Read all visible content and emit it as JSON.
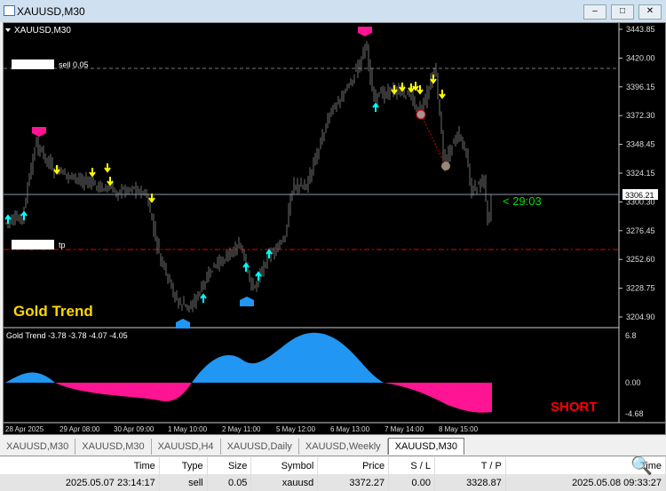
{
  "window": {
    "title": "XAUUSD,M30",
    "minimize": "‒",
    "maximize": "□",
    "close": "✕"
  },
  "chart": {
    "symbol_label": "XAUUSD,M30",
    "sell_label": "sell 0.05",
    "tp_label": "tp",
    "current_price": "3306.21",
    "countdown": "< 29:03",
    "title_text": "Gold Trend",
    "signal": "SHORT",
    "price_axis": [
      "3443.85",
      "3420.00",
      "3396.15",
      "3372.30",
      "3348.45",
      "3324.15",
      "3300.30",
      "3276.45",
      "3252.60",
      "3228.75",
      "3204.90"
    ],
    "indicator_label": "Gold Trend  -3.78 -3.78 -4.07 -4.05",
    "indicator_axis": [
      "6.8",
      "0.00",
      "-4.68"
    ],
    "time_axis": [
      "28 Apr 2025",
      "29 Apr 08:00",
      "30 Apr 09:00",
      "1 May 10:00",
      "2 May 11:00",
      "5 May 12:00",
      "6 May 13:00",
      "7 May 14:00",
      "8 May 15:00"
    ],
    "colors": {
      "bull_area": "#2196f3",
      "bear_area": "#ff1493",
      "buy_arrow": "#00ffff",
      "sell_arrow": "#ffff00",
      "countdown": "#00ff00",
      "signal": "#ff0000",
      "title": "#ffd700"
    }
  },
  "tabs": [
    "XAUUSD,M30",
    "XAUUSD,M30",
    "XAUUSD,H4",
    "XAUUSD,Daily",
    "XAUUSD,Weekly",
    "XAUUSD,M30"
  ],
  "table": {
    "headers": [
      "Time",
      "Type",
      "Size",
      "Symbol",
      "Price",
      "S / L",
      "T / P",
      "Time"
    ],
    "row": [
      "2025.05.07 23:14:17",
      "sell",
      "0.05",
      "xauusd",
      "3372.27",
      "0.00",
      "3328.87",
      "2025.05.08 09:33:27"
    ]
  }
}
